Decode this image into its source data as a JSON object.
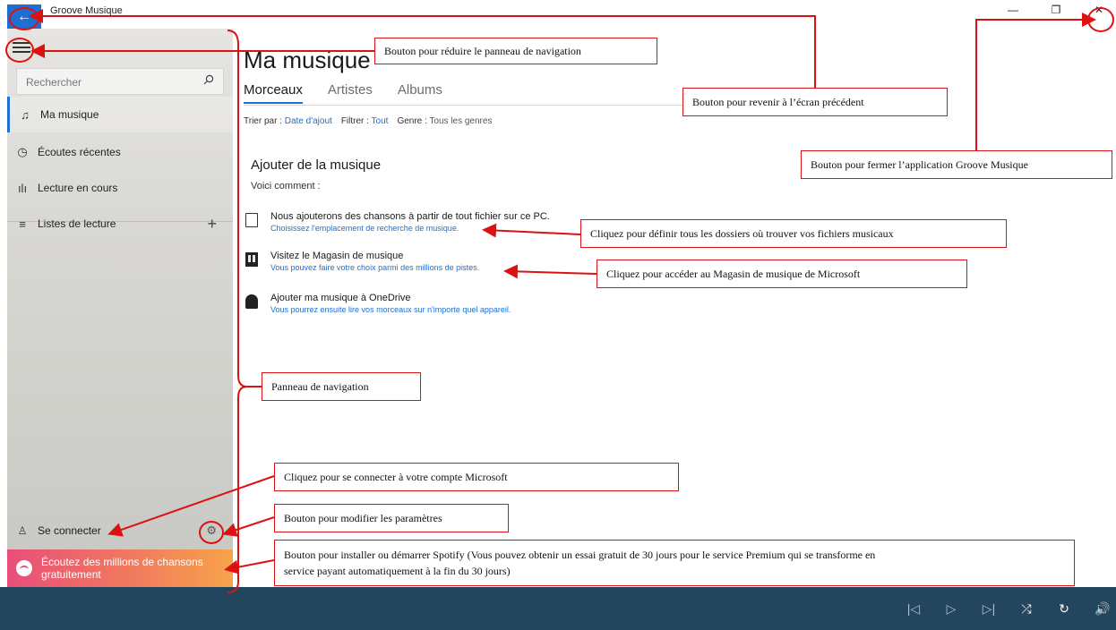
{
  "window": {
    "back_icon": "arrow-left-icon",
    "title": "Groove Musique",
    "minimize_glyph": "—",
    "restore_glyph": "❐",
    "close_glyph": "✕"
  },
  "sidebar": {
    "search_placeholder": "Rechercher",
    "items": [
      {
        "label": "Ma musique",
        "icon": "♫"
      },
      {
        "label": "Écoutes récentes",
        "icon": "◷"
      },
      {
        "label": "Lecture en cours",
        "icon": "ılı"
      },
      {
        "label": "Listes de lecture",
        "icon": "≡"
      }
    ],
    "add_glyph": "+",
    "signin": {
      "label": "Se connecter",
      "icon": "♙"
    },
    "gear_glyph": "⚙",
    "spotify_line1": "Écoutez des millions de chansons",
    "spotify_line2": "gratuitement"
  },
  "main": {
    "title": "Ma musique",
    "tabs": [
      "Morceaux",
      "Artistes",
      "Albums"
    ],
    "filters": {
      "sort_label": "Trier par :",
      "sort_value": "Date d'ajout",
      "filter_label": "Filtrer :",
      "filter_value": "Tout",
      "genre_label": "Genre :",
      "genre_value": "Tous les genres"
    },
    "add_heading": "Ajouter de la musique",
    "add_sub": "Voici comment :",
    "add_items": [
      {
        "title": "Nous ajouterons des chansons à partir de tout fichier sur ce PC.",
        "link": "Choisissez l'emplacement de recherche de musique.",
        "icon": "tablet-icon"
      },
      {
        "title": "Visitez le Magasin de musique",
        "link": "Vous pouvez faire votre choix parmi des millions de pistes.",
        "icon": "store-icon"
      },
      {
        "title": "Ajouter ma musique à OneDrive",
        "link": "Vous pourrez ensuite lire vos morceaux sur n'importe quel appareil.",
        "icon": "cloud-icon"
      }
    ]
  },
  "player": {
    "prev": "|◁",
    "play": "▷",
    "next": "▷|",
    "shuffle": "⤮",
    "repeat": "↻",
    "volume": "🔊"
  },
  "annotations": {
    "collapse": "Bouton pour réduire le panneau de navigation",
    "back": "Bouton pour revenir  à l’écran précédent",
    "close": "Bouton pour fermer l’application  Groove Musique",
    "folders": "Cliquez pour définir  tous les dossiers où trouver vos fichiers musicaux",
    "store": "Cliquez pour accéder au Magasin  de musique de Microsoft",
    "nav_panel": "Panneau de navigation",
    "account": "Cliquez pour se connecter à votre compte Microsoft",
    "settings": "Bouton pour modifier les paramètres",
    "spotify_line1": "Bouton pour installer  ou démarrer Spotify  (Vous pouvez obtenir un essai gratuit  de 30 jours pour le service Premium qui se transforme en",
    "spotify_line2": "service payant automatiquement  à la  fin du 30 jours)"
  },
  "colors": {
    "accent": "#1d6fd1",
    "annotation": "#dd1111",
    "player_bg": "#24455e"
  }
}
